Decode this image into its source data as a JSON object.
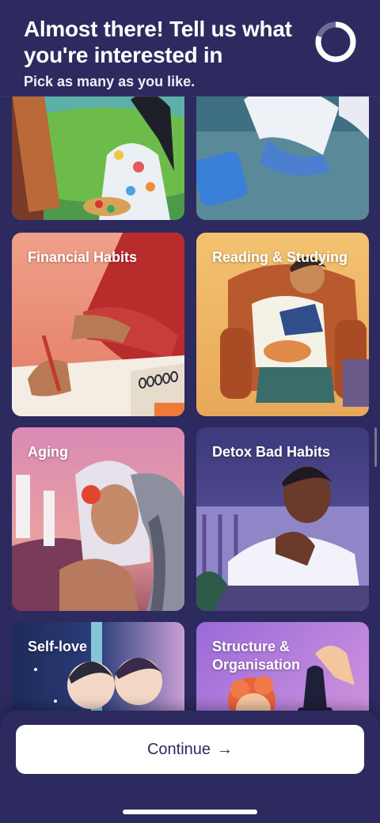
{
  "header": {
    "title": "Almost there! Tell us what you're interested in",
    "subtitle": "Pick as many as you like."
  },
  "progress": {
    "fraction": 0.8
  },
  "topics": [
    {
      "label": "",
      "id": "art"
    },
    {
      "label": "",
      "id": "relax"
    },
    {
      "label": "Financial Habits",
      "id": "financial-habits"
    },
    {
      "label": "Reading & Studying",
      "id": "reading-studying"
    },
    {
      "label": "Aging",
      "id": "aging"
    },
    {
      "label": "Detox Bad Habits",
      "id": "detox-bad-habits"
    },
    {
      "label": "Self-love",
      "id": "self-love"
    },
    {
      "label": "Structure & Organisation",
      "id": "structure-organisation"
    }
  ],
  "footer": {
    "continue_label": "Continue",
    "continue_arrow": "→"
  },
  "colors": {
    "background": "#2c2a5e",
    "button": "#ffffff",
    "button_text": "#2c2a5e"
  }
}
